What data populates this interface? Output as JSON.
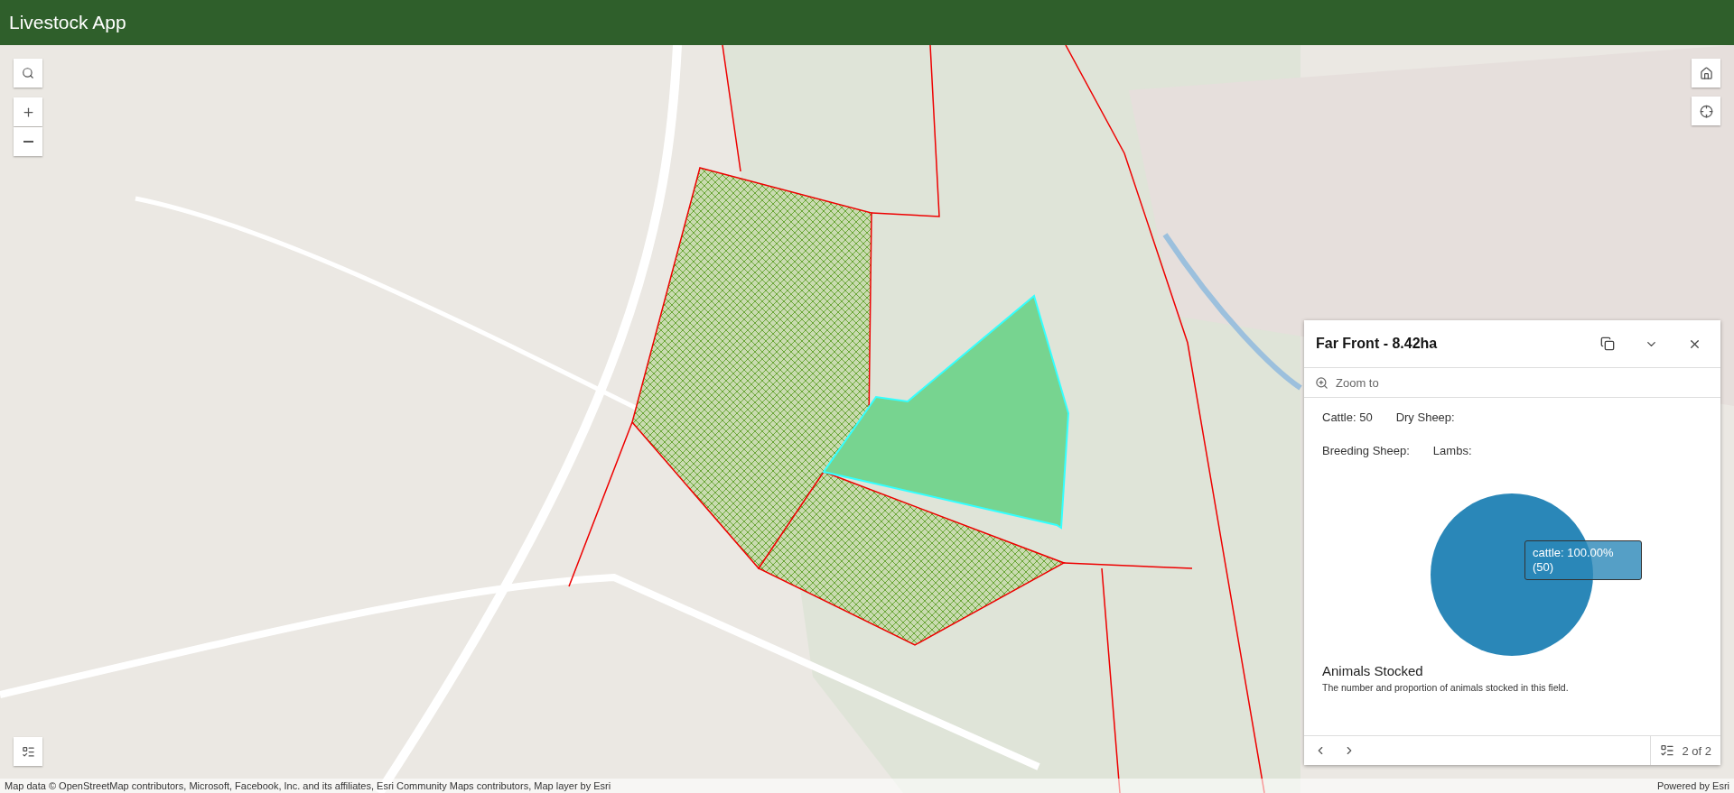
{
  "app_bar": {
    "title": "Livestock App"
  },
  "popup": {
    "title": "Far Front - 8.42ha",
    "zoom_action": "Zoom to",
    "fields": [
      {
        "label": "Cattle: 50"
      },
      {
        "label": "Dry Sheep:"
      },
      {
        "label": "Breeding Sheep:"
      },
      {
        "label": "Lambs:"
      }
    ],
    "chart": {
      "tooltip_label": "cattle: 100.00%",
      "tooltip_count": "(50)"
    },
    "chart_title": "Animals Stocked",
    "chart_caption": "The number and proportion of animals stocked in this field.",
    "pager": "2 of 2"
  },
  "attribution": {
    "text": "Map data © OpenStreetMap contributors, Microsoft, Facebook, Inc. and its affiliates, Esri Community Maps contributors, Map layer by Esri",
    "powered_by": "Powered by Esri"
  }
}
